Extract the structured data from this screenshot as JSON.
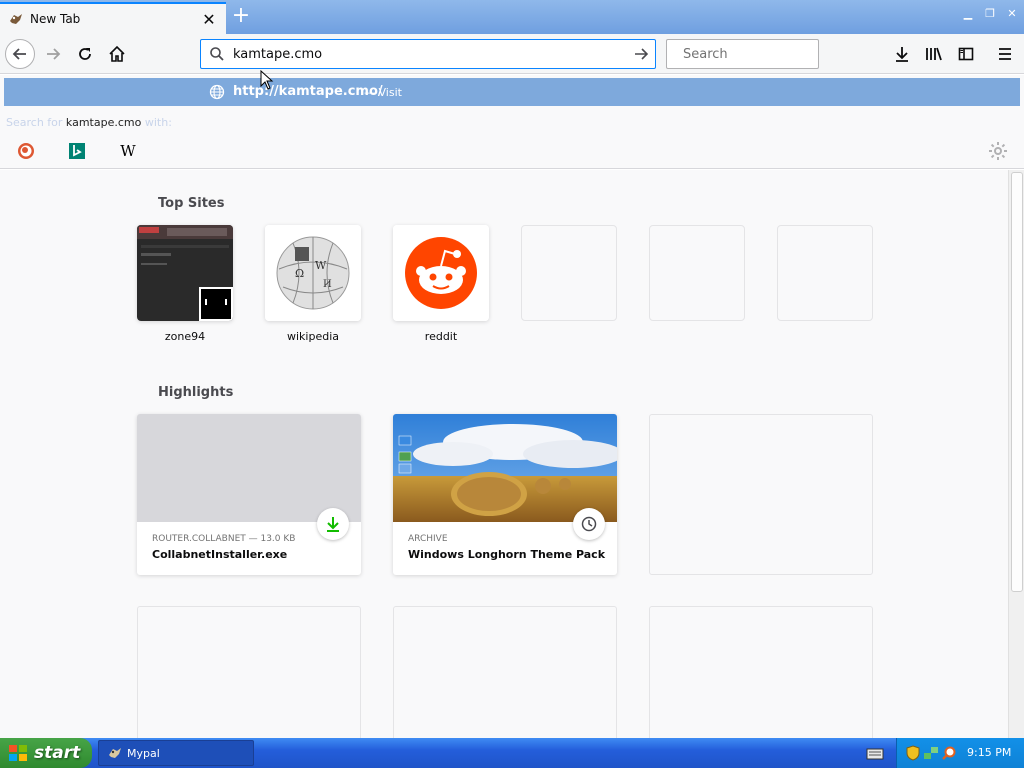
{
  "tab": {
    "title": "New Tab"
  },
  "urlbar": {
    "value": "kamtape.cmo"
  },
  "searchbar": {
    "placeholder": "Search"
  },
  "dropdown": {
    "suggestion_url": "http://kamtape.cmo/",
    "suggestion_sep": "—",
    "suggestion_action": "Visit",
    "search_for_prefix": "Search for",
    "search_for_query": "kamtape.cmo",
    "search_for_suffix": "with:",
    "engines": [
      "duckduckgo-icon",
      "bing-icon",
      "wikipedia-icon"
    ]
  },
  "top_sites": {
    "title": "Top Sites",
    "sites": [
      {
        "label": "zone94"
      },
      {
        "label": "wikipedia"
      },
      {
        "label": "reddit"
      }
    ]
  },
  "highlights": {
    "title": "Highlights",
    "cards": [
      {
        "context": "ROUTER.COLLABNET — 13.0 KB",
        "title": "CollabnetInstaller.exe",
        "badge": "download-icon"
      },
      {
        "context": "ARCHIVE",
        "title": "Windows Longhorn Theme Pack ...",
        "badge": "clock-icon"
      }
    ]
  },
  "taskbar": {
    "start_label": "start",
    "task_label": "Mypal",
    "clock": "9:15 PM"
  },
  "colors": {
    "accent": "#0a84ff",
    "suggest_bg": "#7ea9dc",
    "reddit": "#ff4500",
    "download_green": "#12bc00"
  }
}
